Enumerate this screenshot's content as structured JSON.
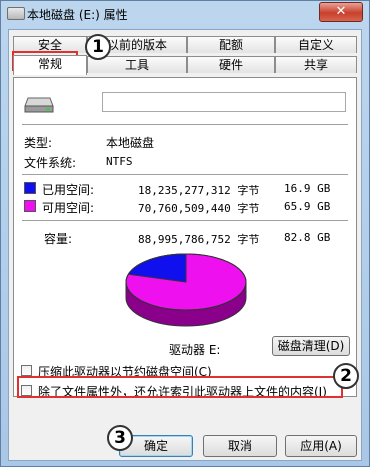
{
  "window": {
    "title": "本地磁盘 (E:) 属性",
    "close_label": "✕"
  },
  "tabs_row1": [
    "安全",
    "以前的版本",
    "配额",
    "自定义"
  ],
  "tabs_row2": [
    "常规",
    "工具",
    "硬件",
    "共享"
  ],
  "general": {
    "volume_name_value": "",
    "type_label": "类型:",
    "type_value": "本地磁盘",
    "fs_label": "文件系统:",
    "fs_value": "NTFS",
    "used_label": "已用空间:",
    "used_bytes": "18,235,277,312 字节",
    "used_size": "16.9 GB",
    "free_label": "可用空间:",
    "free_bytes": "70,760,509,440 字节",
    "free_size": "65.9 GB",
    "capacity_label": "容量:",
    "capacity_bytes": "88,995,786,752 字节",
    "capacity_size": "82.8 GB",
    "drive_label": "驱动器 E:",
    "cleanup_button": "磁盘清理(D)",
    "used_fraction": 0.205,
    "used_color": "#1010ee",
    "free_color": "#ee10ee"
  },
  "options": {
    "compress_label": "压缩此驱动器以节约磁盘空间(C)",
    "index_label": "除了文件属性外，还允许索引此驱动器上文件的内容(I)"
  },
  "buttons": {
    "ok": "确定",
    "cancel": "取消",
    "apply": "应用(A)"
  },
  "annotations": [
    "1",
    "2",
    "3"
  ]
}
